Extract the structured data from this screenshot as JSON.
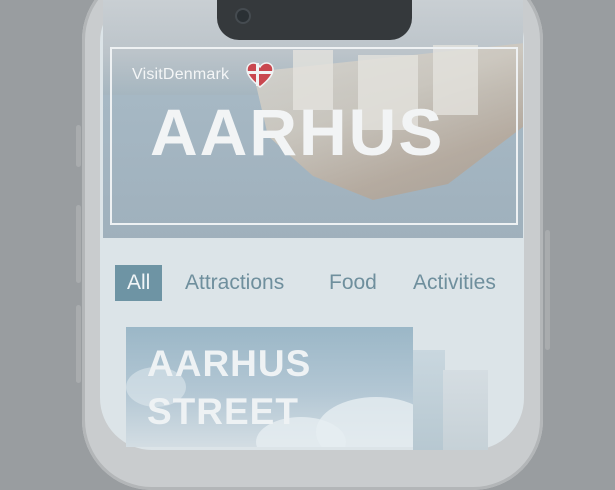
{
  "hero": {
    "brand": "VisitDenmark",
    "title": "AARHUS"
  },
  "tabs": [
    {
      "label": "All",
      "active": true
    },
    {
      "label": "Attractions",
      "active": false
    },
    {
      "label": "Food",
      "active": false
    },
    {
      "label": "Activities",
      "active": false
    }
  ],
  "card": {
    "title_line1": "AARHUS",
    "title_line2": "STREET"
  },
  "colors": {
    "accent": "#6e94a4",
    "heart_red": "#c9474f"
  }
}
